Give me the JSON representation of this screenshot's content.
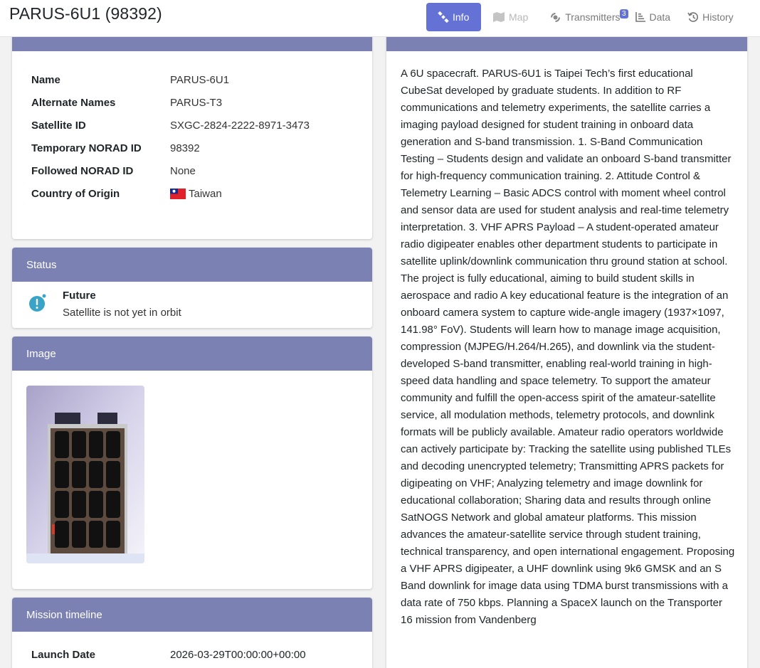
{
  "page": {
    "title": "PARUS-6U1 (98392)"
  },
  "tabs": {
    "info": "Info",
    "map": "Map",
    "transmitters": "Transmitters",
    "transmitters_count": "3",
    "data": "Data",
    "history": "History"
  },
  "info": {
    "name_label": "Name",
    "name": "PARUS-6U1",
    "alt_label": "Alternate Names",
    "alt": "PARUS-T3",
    "satid_label": "Satellite ID",
    "satid": "SXGC-2824-2222-8971-3473",
    "tempnorad_label": "Temporary NORAD ID",
    "tempnorad": "98392",
    "followed_label": "Followed NORAD ID",
    "followed": "None",
    "country_label": "Country of Origin",
    "country": "Taiwan"
  },
  "status": {
    "header": "Status",
    "title": "Future",
    "text": "Satellite is not yet in orbit"
  },
  "image": {
    "header": "Image"
  },
  "timeline": {
    "header": "Mission timeline",
    "launch_label": "Launch Date",
    "launch": "2026-03-29T00:00:00+00:00"
  },
  "description": {
    "text": "A 6U spacecraft. PARUS-6U1 is Taipei Tech’s first educational CubeSat developed by graduate students. In addition to RF communications and telemetry experiments, the satellite carries a imaging payload designed for student training in onboard data generation and S-band transmission. 1. S-Band Communication Testing – Students design and validate an onboard S-band transmitter for high-frequency communication training. 2. Attitude Control & Telemetry Learning – Basic ADCS control with moment wheel control and sensor data are used for student analysis and real-time telemetry interpretation. 3. VHF APRS Payload – A student-operated amateur radio digipeater enables other department students to participate in satellite uplink/downlink communication thru ground station at school. The project is fully educational, aiming to build student skills in aerospace and radio A key educational feature is the integration of an onboard camera system to capture wide-angle imagery (1937×1097, 141.98° FoV). Students will learn how to manage image acquisition, compression (MJPEG/H.264/H.265), and downlink via the student-developed S-band transmitter, enabling real-world training in high-speed data handling and space telemetry. To support the amateur community and fulfill the open-access spirit of the amateur-satellite service, all modulation methods, telemetry protocols, and downlink formats will be publicly available. Amateur radio operators worldwide can actively participate by: Tracking the satellite using published TLEs and decoding unencrypted telemetry; Transmitting APRS packets for digipeating on VHF; Analyzing telemetry and image downlink for educational collaboration; Sharing data and results through online SatNOGS Network and global amateur platforms. This mission advances the amateur-satellite service through student training, technical transparency, and open international engagement. Proposing a VHF APRS digipeater, a UHF downlink using 9k6 GMSK and an S Band downlink for image data using TDMA burst transmissions with a data rate of 750 kbps. Planning a SpaceX launch on the Transporter 16 mission from Vandenberg"
  },
  "colors": {
    "header_bg": "#7c81b3",
    "tab_active": "#6472d6",
    "status_icon": "#3aa4c8"
  },
  "icons": {
    "info": "satellite-icon",
    "map": "map-icon",
    "transmitters": "signal-icon",
    "data": "chart-icon",
    "history": "history-icon",
    "status": "exclamation-circle-icon"
  }
}
